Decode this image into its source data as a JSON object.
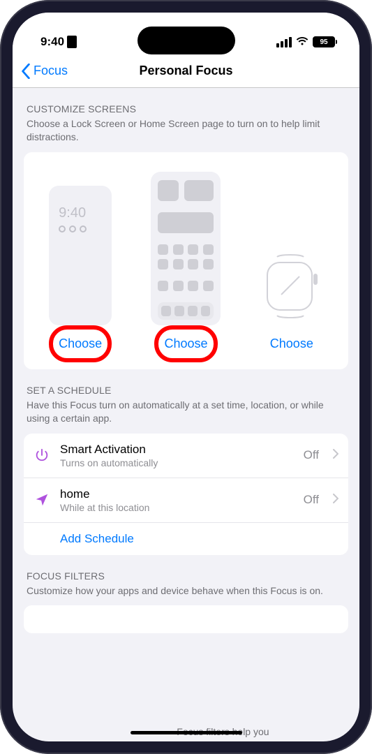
{
  "status": {
    "time": "9:40",
    "battery": "95"
  },
  "nav": {
    "back": "Focus",
    "title": "Personal Focus"
  },
  "customize": {
    "header": "CUSTOMIZE SCREENS",
    "desc": "Choose a Lock Screen or Home Screen page to turn on to help limit distractions.",
    "lockPreviewTime": "9:40",
    "choose": "Choose"
  },
  "schedule": {
    "header": "SET A SCHEDULE",
    "desc": "Have this Focus turn on automatically at a set time, location, or while using a certain app.",
    "rows": [
      {
        "title": "Smart Activation",
        "sub": "Turns on automatically",
        "value": "Off"
      },
      {
        "title": "home",
        "sub": "While at this location",
        "value": "Off"
      }
    ],
    "add": "Add Schedule"
  },
  "filters": {
    "header": "FOCUS FILTERS",
    "desc": "Customize how your apps and device behave when this Focus is on.",
    "peek": "Focus filters help you"
  }
}
